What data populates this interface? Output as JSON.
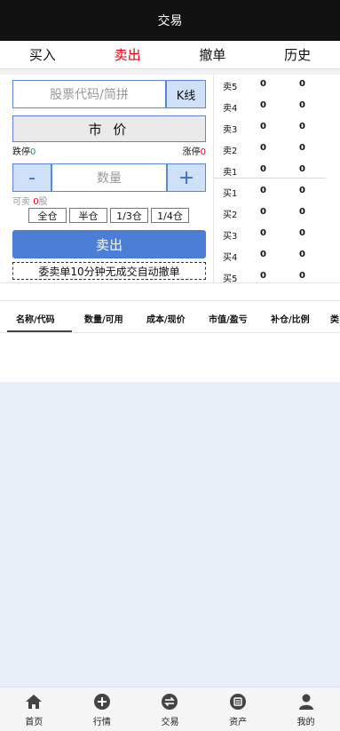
{
  "header": {
    "title": "交易"
  },
  "tabs": [
    {
      "label": "买入"
    },
    {
      "label": "卖出"
    },
    {
      "label": "撤单"
    },
    {
      "label": "历史"
    }
  ],
  "form": {
    "code_placeholder": "股票代码/简拼",
    "kline_label": "K线",
    "price_label": "市 价",
    "limit_down_label": "跌停",
    "limit_down_value": "0",
    "limit_up_label": "涨停",
    "limit_up_value": "0",
    "minus_label": "-",
    "qty_placeholder": "数量",
    "plus_label": "+",
    "avail_label": "可卖",
    "avail_value": "0",
    "avail_unit": "股",
    "ratios": [
      "全仓",
      "半仓",
      "1/3仓",
      "1/4仓"
    ],
    "submit_label": "卖出",
    "notice": "委卖单10分钟无成交自动撤单"
  },
  "orderbook": {
    "asks": [
      {
        "name": "卖5",
        "price": "0",
        "volume": "0"
      },
      {
        "name": "卖4",
        "price": "0",
        "volume": "0"
      },
      {
        "name": "卖3",
        "price": "0",
        "volume": "0"
      },
      {
        "name": "卖2",
        "price": "0",
        "volume": "0"
      },
      {
        "name": "卖1",
        "price": "0",
        "volume": "0"
      }
    ],
    "bids": [
      {
        "name": "买1",
        "price": "0",
        "volume": "0"
      },
      {
        "name": "买2",
        "price": "0",
        "volume": "0"
      },
      {
        "name": "买3",
        "price": "0",
        "volume": "0"
      },
      {
        "name": "买4",
        "price": "0",
        "volume": "0"
      },
      {
        "name": "买5",
        "price": "0",
        "volume": "0"
      }
    ]
  },
  "holdings": {
    "columns": [
      "名称/代码",
      "数量/可用",
      "成本/现价",
      "市值/盈亏",
      "补仓/比例",
      "类"
    ]
  },
  "bottom_nav": [
    {
      "label": "首页",
      "icon": "home-icon"
    },
    {
      "label": "行情",
      "icon": "plus-circle-icon"
    },
    {
      "label": "交易",
      "icon": "exchange-icon"
    },
    {
      "label": "资产",
      "icon": "wallet-icon"
    },
    {
      "label": "我的",
      "icon": "user-icon"
    }
  ],
  "colors": {
    "header_bg": "#111111",
    "active_tab": "#e60012",
    "accent_blue": "#4b7fd7",
    "input_border": "#5a88d6",
    "btn_light_blue": "#cfe1f8",
    "limit_down": "#16a34a",
    "limit_up": "#e60012",
    "content_bg": "#e9eff8"
  }
}
